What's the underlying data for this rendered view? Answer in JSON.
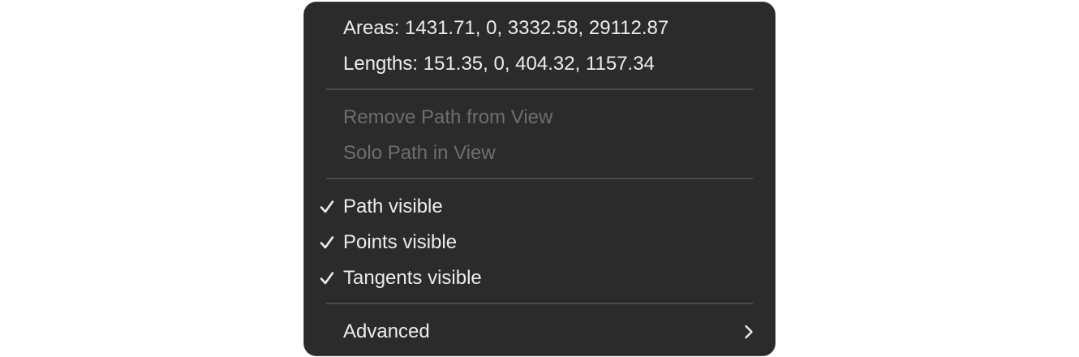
{
  "menu": {
    "info": {
      "areas": "Areas: 1431.71, 0, 3332.58, 29112.87",
      "lengths": "Lengths: 151.35, 0, 404.32, 1157.34"
    },
    "view_actions": {
      "remove_path": "Remove Path from View",
      "solo_path": "Solo Path in View"
    },
    "toggles": {
      "path_visible": {
        "label": "Path visible",
        "checked": true
      },
      "points_visible": {
        "label": "Points visible",
        "checked": true
      },
      "tangents_visible": {
        "label": "Tangents visible",
        "checked": true
      }
    },
    "advanced": {
      "label": "Advanced",
      "icon": "chevron-right-icon"
    },
    "icons": {
      "check": "checkmark-icon"
    },
    "colors": {
      "background": "#2b2b2b",
      "text": "#ececec",
      "disabled_text": "#6e6e6e",
      "separator": "#4a4a4a"
    }
  }
}
